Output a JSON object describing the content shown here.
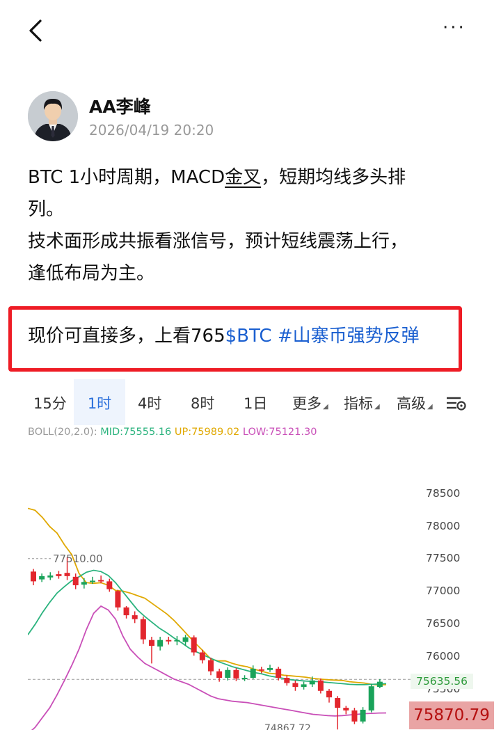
{
  "nav": {
    "back_icon": "chevron-left-icon",
    "more_icon": "more-dots-icon",
    "more_glyph": "···"
  },
  "post": {
    "author": "AA李峰",
    "date": "2026/04/19 20:20",
    "lines": [
      [
        "BTC 1小时周期，MACD",
        "金叉",
        "，短期均线多头排"
      ],
      "列。",
      "技术面形成共振看涨信号，预计短线震荡上行，",
      "逢低布局为主。"
    ],
    "highlight": {
      "text": "现价可直接多，上看765",
      "ticker": "$BTC",
      "tag": "#山寨币强势反弹"
    }
  },
  "chart": {
    "tabs": [
      "15分",
      "1时",
      "4时",
      "8时",
      "1日",
      "更多",
      "指标",
      "高级"
    ],
    "active_tab": "1时",
    "settings_icon": "chart-settings-icon",
    "boll": {
      "label": "BOLL(20,2.0):",
      "mid": "MID:75555.16",
      "up": "UP:75989.02",
      "low": "LOW:75121.30",
      "colors": {
        "mid": "#2bb37e",
        "up": "#e0a800",
        "low": "#c94fb8"
      }
    },
    "price_axis": [
      "78500",
      "78000",
      "77500",
      "77000",
      "76500",
      "76000",
      "75500"
    ],
    "high_marker": "77510.00",
    "low_marker": "74867.72",
    "current_price": "75635.56",
    "live_price": "75870.79",
    "colors": {
      "up": "#1aa35a",
      "down": "#e2262d",
      "active_tab": "#2a6fdb"
    }
  },
  "chart_data": {
    "type": "line",
    "title": "",
    "ylim": [
      74800,
      78800
    ],
    "yticks": [
      78500,
      78000,
      77500,
      77000,
      76500,
      76000,
      75500
    ],
    "series": [
      {
        "name": "UP",
        "values": [
          78260,
          78230,
          78120,
          77980,
          77880,
          77700,
          77550,
          77260,
          77120,
          77110,
          77120,
          77080,
          77000,
          76990,
          76960,
          76920,
          76880,
          76800,
          76720,
          76640,
          76540,
          76420,
          76300,
          76180,
          76070,
          75950,
          75920,
          75920,
          75880,
          75850,
          75830,
          75790,
          75760,
          75730,
          75720,
          75700,
          75690,
          75680,
          75670,
          75650,
          75640,
          75630,
          75625,
          75620,
          75600,
          75590,
          75580,
          75560,
          75550,
          75555
        ]
      },
      {
        "name": "MID",
        "values": [
          76320,
          76480,
          76660,
          76820,
          76960,
          77060,
          77150,
          77210,
          77280,
          77310,
          77290,
          77230,
          77120,
          76980,
          76840,
          76700,
          76600,
          76510,
          76420,
          76350,
          76270,
          76200,
          76120,
          76060,
          76010,
          75960,
          75910,
          75870,
          75830,
          75800,
          75770,
          75740,
          75720,
          75690,
          75670,
          75650,
          75630,
          75620,
          75610,
          75605,
          75600,
          75590,
          75580,
          75570,
          75560,
          75555,
          75555,
          75560,
          75565,
          75570
        ]
      },
      {
        "name": "LOW",
        "values": [
          74800,
          74900,
          75050,
          75200,
          75400,
          75620,
          75850,
          76100,
          76400,
          76650,
          76760,
          76700,
          76560,
          76300,
          76100,
          75980,
          75880,
          75820,
          75760,
          75700,
          75640,
          75600,
          75560,
          75500,
          75440,
          75380,
          75340,
          75320,
          75300,
          75290,
          75280,
          75260,
          75240,
          75220,
          75200,
          75180,
          75160,
          75140,
          75120,
          75100,
          75090,
          75080,
          75075,
          75080,
          75090,
          75100,
          75110,
          75115,
          75120,
          75121
        ]
      }
    ],
    "candles": [
      [
        77290,
        77140,
        77330,
        77080
      ],
      [
        77170,
        77220,
        77260,
        77130
      ],
      [
        77200,
        77230,
        77280,
        77160
      ],
      [
        77250,
        77220,
        77300,
        77180
      ],
      [
        77270,
        77220,
        77510,
        77160
      ],
      [
        77210,
        77080,
        77260,
        77020
      ],
      [
        77090,
        77130,
        77190,
        77030
      ],
      [
        77140,
        77150,
        77210,
        77100
      ],
      [
        77160,
        77140,
        77230,
        77110
      ],
      [
        77140,
        77020,
        77180,
        76980
      ],
      [
        76990,
        76740,
        77010,
        76690
      ],
      [
        76740,
        76620,
        76760,
        76570
      ],
      [
        76620,
        76560,
        76680,
        76500
      ],
      [
        76560,
        76250,
        76600,
        76180
      ],
      [
        76240,
        76150,
        76290,
        75880
      ],
      [
        76140,
        76240,
        76290,
        76080
      ],
      [
        76240,
        76220,
        76290,
        76170
      ],
      [
        76230,
        76240,
        76300,
        76160
      ],
      [
        76210,
        76280,
        76320,
        76150
      ],
      [
        76280,
        76050,
        76310,
        76000
      ],
      [
        76050,
        75930,
        76090,
        75880
      ],
      [
        75930,
        75760,
        75970,
        75700
      ],
      [
        75760,
        75660,
        75800,
        75600
      ],
      [
        75660,
        75780,
        75820,
        75620
      ],
      [
        75780,
        75650,
        75810,
        75610
      ],
      [
        75650,
        75660,
        75700,
        75610
      ],
      [
        75660,
        75800,
        75850,
        75640
      ],
      [
        75790,
        75770,
        75830,
        75730
      ],
      [
        75780,
        75810,
        75860,
        75750
      ],
      [
        75800,
        75660,
        75830,
        75620
      ],
      [
        75660,
        75580,
        75700,
        75540
      ],
      [
        75580,
        75520,
        75620,
        75460
      ],
      [
        75520,
        75560,
        75600,
        75480
      ],
      [
        75560,
        75620,
        75680,
        75520
      ],
      [
        75620,
        75460,
        75650,
        75420
      ],
      [
        75460,
        75360,
        75490,
        75280
      ],
      [
        75350,
        75200,
        75380,
        74867
      ],
      [
        75200,
        75160,
        75230,
        75100
      ],
      [
        75160,
        74990,
        75200,
        74950
      ],
      [
        74990,
        75170,
        75210,
        74960
      ],
      [
        75160,
        75530,
        75570,
        75130
      ],
      [
        75520,
        75600,
        75640,
        75500
      ]
    ]
  }
}
